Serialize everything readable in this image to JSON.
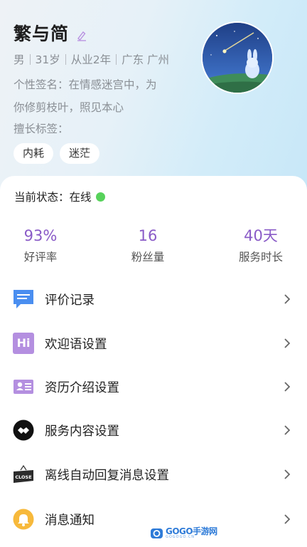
{
  "profile": {
    "name": "繁与简",
    "meta": [
      "男",
      "31岁",
      "从业2年",
      "广东 广州"
    ],
    "signature_line1": "个性签名：在情感迷宫中，为",
    "signature_line2": "你修剪枝叶，照见本心",
    "tags_label": "擅长标签：",
    "tags": [
      "内耗",
      "迷茫"
    ]
  },
  "status": {
    "label": "当前状态：",
    "value": "在线",
    "color": "#57d25b"
  },
  "stats": [
    {
      "value": "93%",
      "label": "好评率"
    },
    {
      "value": "16",
      "label": "粉丝量"
    },
    {
      "value": "40天",
      "label": "服务时长"
    }
  ],
  "menu": [
    {
      "label": "评价记录",
      "icon": "comment-icon"
    },
    {
      "label": "欢迎语设置",
      "icon": "hi-icon"
    },
    {
      "label": "资历介绍设置",
      "icon": "id-card-icon"
    },
    {
      "label": "服务内容设置",
      "icon": "handshake-icon"
    },
    {
      "label": "离线自动回复消息设置",
      "icon": "close-sign-icon"
    },
    {
      "label": "消息通知",
      "icon": "bell-icon"
    }
  ],
  "icons": {
    "hi_text": "Hi",
    "close_text": "CLOSE"
  },
  "watermark": {
    "text": "GOGO手游网",
    "sub": "GOGOGO.CN"
  },
  "colors": {
    "accent_purple": "#8a5bc7",
    "comment_blue": "#4a8ef0",
    "hi_purple": "#b48fe0",
    "bell_orange": "#f7b93b"
  }
}
